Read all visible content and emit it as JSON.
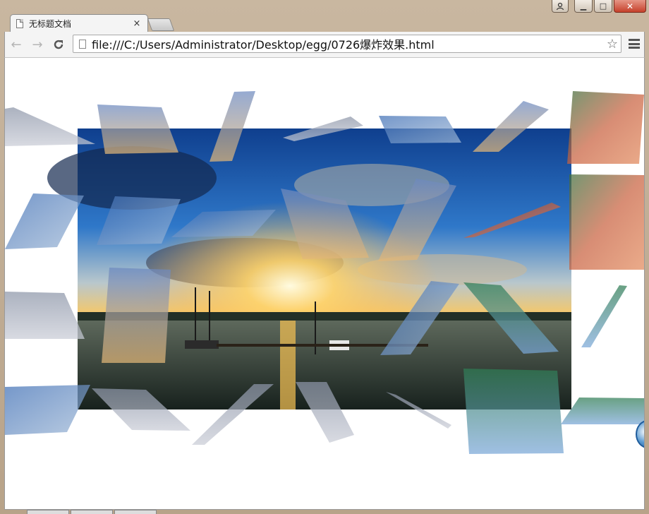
{
  "browser": {
    "tab_title": "无标题文档",
    "tab_close_glyph": "×",
    "url": "file:///C:/Users/Administrator/Desktop/egg/0726爆炸效果.html",
    "back_glyph": "←",
    "forward_glyph": "→",
    "reload_glyph": "C",
    "star_glyph": "☆",
    "caption": {
      "minimize": "▁",
      "maximize": "□",
      "close": "✕",
      "user": "👤"
    }
  },
  "icons": [
    "document-icon",
    "back-arrow-icon",
    "forward-arrow-icon",
    "reload-icon",
    "page-icon",
    "star-icon",
    "menu-icon",
    "user-icon",
    "minimize-icon",
    "maximize-icon",
    "close-icon"
  ],
  "page": {
    "effect": "explosion",
    "photo_subject": "sunset over marina"
  }
}
